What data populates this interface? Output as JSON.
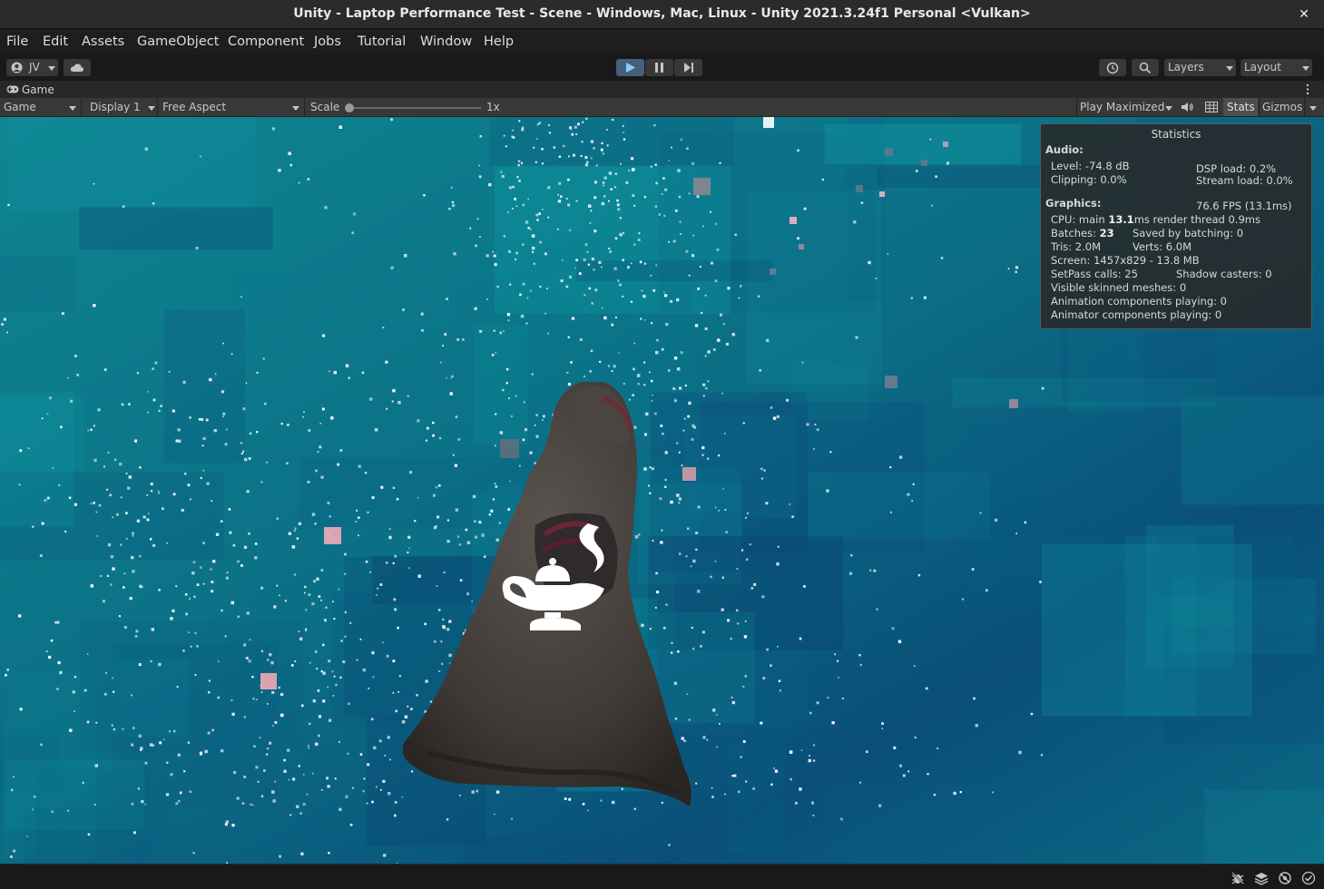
{
  "window": {
    "title": "Unity - Laptop Performance Test - Scene - Windows, Mac, Linux - Unity 2021.3.24f1 Personal <Vulkan>",
    "close_glyph": "✕"
  },
  "menu": [
    "File",
    "Edit",
    "Assets",
    "GameObject",
    "Component",
    "Jobs",
    "Tutorial",
    "Window",
    "Help"
  ],
  "toolbar": {
    "account_label": "JV",
    "play_state": "playing",
    "layers_label": "Layers",
    "layout_label": "Layout"
  },
  "game_view": {
    "tab_label": "Game",
    "view_mode": "Game",
    "display": "Display 1",
    "aspect": "Free Aspect",
    "scale_label": "Scale",
    "scale_value": "1x",
    "play_mode": "Play Maximized",
    "stats_label": "Stats",
    "gizmos_label": "Gizmos"
  },
  "stats": {
    "title": "Statistics",
    "audio_header": "Audio:",
    "level": "Level: -74.8 dB",
    "clipping": "Clipping: 0.0%",
    "dsp_load": "DSP load: 0.2%",
    "stream_load": "Stream load: 0.0%",
    "graphics_header": "Graphics:",
    "fps": "76.6 FPS (13.1ms)",
    "cpu_prefix": "CPU: main ",
    "cpu_main": "13.1",
    "cpu_suffix": "ms  render thread 0.9ms",
    "batches_prefix": "Batches: ",
    "batches": "23",
    "saved_by_batching": "Saved by batching: 0",
    "tris": "Tris: 2.0M",
    "verts": "Verts: 6.0M",
    "screen": "Screen: 1457x829 - 13.8 MB",
    "setpass": "SetPass calls: 25",
    "shadow_casters": "Shadow casters: 0",
    "skinned": "Visible skinned meshes: 0",
    "animation": "Animation components playing: 0",
    "animator": "Animator components playing: 0"
  },
  "colors": {
    "play_active": "#46607c",
    "bg_teal": "#0d7e8c",
    "bg_deep": "#0a3d6a"
  }
}
